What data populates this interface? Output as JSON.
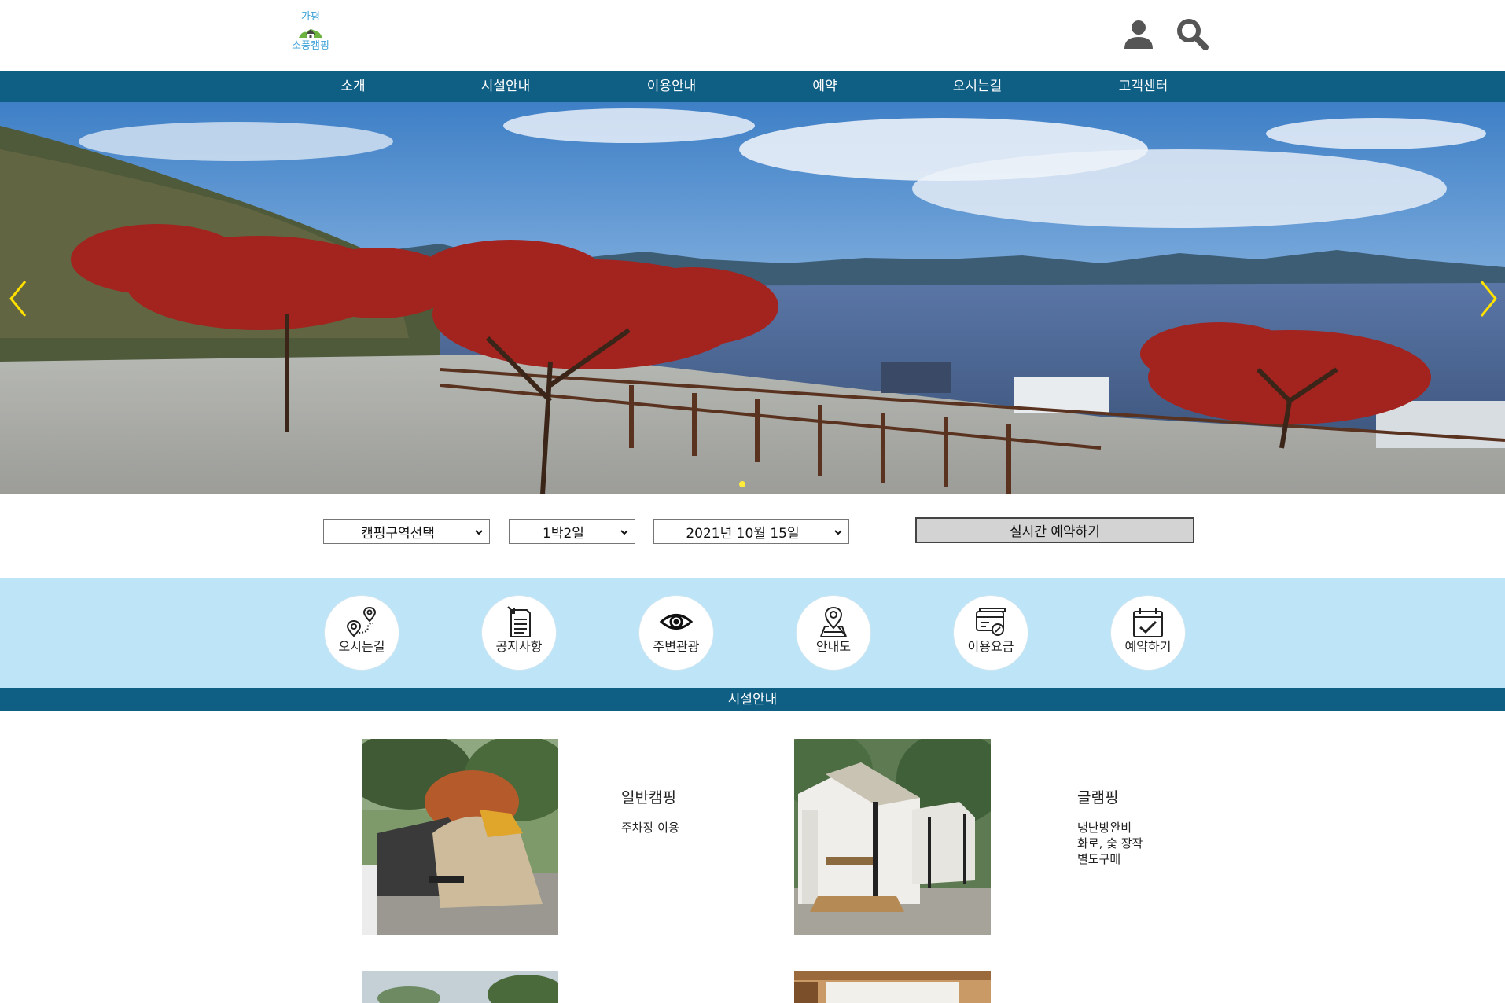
{
  "header": {
    "logo_line1": "가평",
    "logo_line2": "소풍캠핑",
    "icons": [
      "user-icon",
      "search-icon"
    ]
  },
  "nav": {
    "items": [
      {
        "label": "소개"
      },
      {
        "label": "시설안내"
      },
      {
        "label": "이용안내"
      },
      {
        "label": "예약"
      },
      {
        "label": "오시는길"
      },
      {
        "label": "고객센터"
      }
    ]
  },
  "hero": {
    "slide_count": 1,
    "active_slide": 1,
    "arrow_color": "#ffe000"
  },
  "booking": {
    "zone_select": "캠핑구역선택",
    "nights_select": "1박2일",
    "date_select": "2021년 10월 15일",
    "reserve_button": "실시간 예약하기"
  },
  "quick_links": [
    {
      "label": "오시는길",
      "icon": "route-pin-icon"
    },
    {
      "label": "공지사항",
      "icon": "notice-document-icon"
    },
    {
      "label": "주변관광",
      "icon": "eye-icon"
    },
    {
      "label": "안내도",
      "icon": "map-pin-icon"
    },
    {
      "label": "이용요금",
      "icon": "payment-card-icon"
    },
    {
      "label": "예약하기",
      "icon": "calendar-check-icon"
    }
  ],
  "section": {
    "title": "시설안내"
  },
  "facilities": [
    {
      "title": "일반캠핑",
      "desc": [
        "주차장 이용"
      ]
    },
    {
      "title": "글램핑",
      "desc": [
        "냉난방완비",
        "화로, 숯 장작",
        "별도구매"
      ]
    }
  ],
  "colors": {
    "nav_bg": "#0f5e84",
    "quick_bg": "#bde4f7",
    "logo_text": "#3fa3d8",
    "button_bg": "#d3d3d3"
  }
}
